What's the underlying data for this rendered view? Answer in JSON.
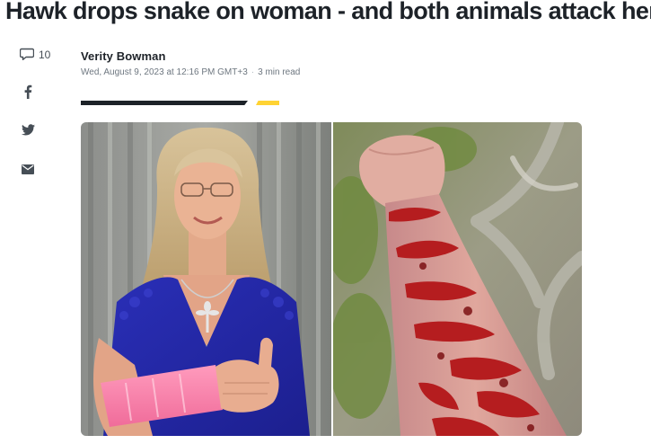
{
  "article": {
    "headline": "Hawk drops snake on woman - and both animals attack her",
    "author": "Verity Bowman",
    "date": "Wed, August 9, 2023 at 12:16 PM GMT+3",
    "read_time": "3 min read",
    "separator": "·"
  },
  "share": {
    "comment_count": "10",
    "items": [
      {
        "icon": "comment-icon"
      },
      {
        "icon": "facebook-icon"
      },
      {
        "icon": "twitter-icon"
      },
      {
        "icon": "email-icon"
      }
    ]
  },
  "colors": {
    "accent_yellow": "#ffd333",
    "headline": "#1d2228",
    "meta": "#6e7780"
  },
  "image": {
    "panels": [
      "woman-with-arm-cast-photo",
      "injured-forearm-photo"
    ]
  }
}
